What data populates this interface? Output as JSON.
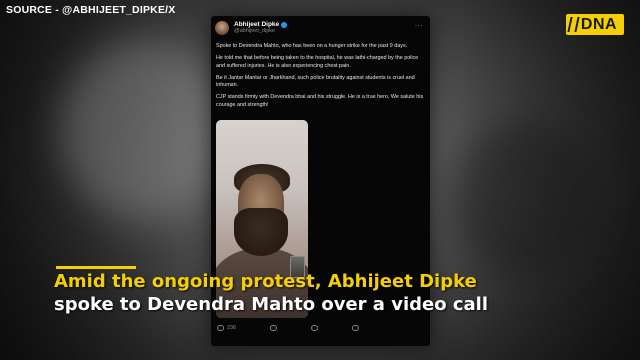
{
  "source_label": "SOURCE - @ABHIJEET_DIPKE/X",
  "logo": {
    "text": "DNA",
    "accent": "#f5d000"
  },
  "tweet": {
    "author_name": "Abhijeet Dipke",
    "author_handle": "@abhijeet_dipke",
    "verified_icon": "verified-badge-icon",
    "more_icon": "more-horizontal-icon",
    "paragraphs": [
      "Spoke to Devendra Mahto, who has been on a hunger strike for the past 9 days.",
      "He told me that before being taken to the hospital, he was lathi-charged by the police and suffered injuries. He is also experiencing chest pain.",
      "Be it Jantar Mantar or Jharkhand, such police brutality against students is cruel and inhuman.",
      "CJP stands firmly with Devendra bhai and his struggle. He is a true hero. We salute his courage and strength!"
    ],
    "actions": [
      {
        "icon": "reply-icon",
        "count": "236"
      },
      {
        "icon": "repost-icon",
        "count": ""
      },
      {
        "icon": "like-icon",
        "count": ""
      },
      {
        "icon": "views-icon",
        "count": ""
      }
    ]
  },
  "caption": {
    "line1": "Amid the ongoing protest, Abhijeet Dipke",
    "line2": "spoke to Devendra Mahto over a video call",
    "line1_color": "#f5d000",
    "line2_color": "#ffffff"
  }
}
